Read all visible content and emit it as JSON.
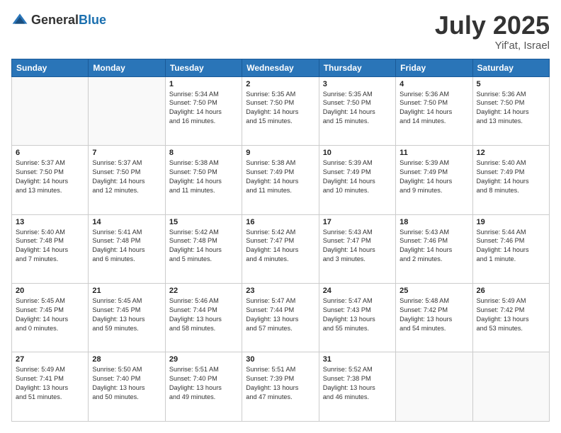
{
  "header": {
    "logo_general": "General",
    "logo_blue": "Blue",
    "month_title": "July 2025",
    "location": "Yif'at, Israel"
  },
  "days_of_week": [
    "Sunday",
    "Monday",
    "Tuesday",
    "Wednesday",
    "Thursday",
    "Friday",
    "Saturday"
  ],
  "weeks": [
    [
      {
        "day": "",
        "info": ""
      },
      {
        "day": "",
        "info": ""
      },
      {
        "day": "1",
        "info": "Sunrise: 5:34 AM\nSunset: 7:50 PM\nDaylight: 14 hours\nand 16 minutes."
      },
      {
        "day": "2",
        "info": "Sunrise: 5:35 AM\nSunset: 7:50 PM\nDaylight: 14 hours\nand 15 minutes."
      },
      {
        "day": "3",
        "info": "Sunrise: 5:35 AM\nSunset: 7:50 PM\nDaylight: 14 hours\nand 15 minutes."
      },
      {
        "day": "4",
        "info": "Sunrise: 5:36 AM\nSunset: 7:50 PM\nDaylight: 14 hours\nand 14 minutes."
      },
      {
        "day": "5",
        "info": "Sunrise: 5:36 AM\nSunset: 7:50 PM\nDaylight: 14 hours\nand 13 minutes."
      }
    ],
    [
      {
        "day": "6",
        "info": "Sunrise: 5:37 AM\nSunset: 7:50 PM\nDaylight: 14 hours\nand 13 minutes."
      },
      {
        "day": "7",
        "info": "Sunrise: 5:37 AM\nSunset: 7:50 PM\nDaylight: 14 hours\nand 12 minutes."
      },
      {
        "day": "8",
        "info": "Sunrise: 5:38 AM\nSunset: 7:50 PM\nDaylight: 14 hours\nand 11 minutes."
      },
      {
        "day": "9",
        "info": "Sunrise: 5:38 AM\nSunset: 7:49 PM\nDaylight: 14 hours\nand 11 minutes."
      },
      {
        "day": "10",
        "info": "Sunrise: 5:39 AM\nSunset: 7:49 PM\nDaylight: 14 hours\nand 10 minutes."
      },
      {
        "day": "11",
        "info": "Sunrise: 5:39 AM\nSunset: 7:49 PM\nDaylight: 14 hours\nand 9 minutes."
      },
      {
        "day": "12",
        "info": "Sunrise: 5:40 AM\nSunset: 7:49 PM\nDaylight: 14 hours\nand 8 minutes."
      }
    ],
    [
      {
        "day": "13",
        "info": "Sunrise: 5:40 AM\nSunset: 7:48 PM\nDaylight: 14 hours\nand 7 minutes."
      },
      {
        "day": "14",
        "info": "Sunrise: 5:41 AM\nSunset: 7:48 PM\nDaylight: 14 hours\nand 6 minutes."
      },
      {
        "day": "15",
        "info": "Sunrise: 5:42 AM\nSunset: 7:48 PM\nDaylight: 14 hours\nand 5 minutes."
      },
      {
        "day": "16",
        "info": "Sunrise: 5:42 AM\nSunset: 7:47 PM\nDaylight: 14 hours\nand 4 minutes."
      },
      {
        "day": "17",
        "info": "Sunrise: 5:43 AM\nSunset: 7:47 PM\nDaylight: 14 hours\nand 3 minutes."
      },
      {
        "day": "18",
        "info": "Sunrise: 5:43 AM\nSunset: 7:46 PM\nDaylight: 14 hours\nand 2 minutes."
      },
      {
        "day": "19",
        "info": "Sunrise: 5:44 AM\nSunset: 7:46 PM\nDaylight: 14 hours\nand 1 minute."
      }
    ],
    [
      {
        "day": "20",
        "info": "Sunrise: 5:45 AM\nSunset: 7:45 PM\nDaylight: 14 hours\nand 0 minutes."
      },
      {
        "day": "21",
        "info": "Sunrise: 5:45 AM\nSunset: 7:45 PM\nDaylight: 13 hours\nand 59 minutes."
      },
      {
        "day": "22",
        "info": "Sunrise: 5:46 AM\nSunset: 7:44 PM\nDaylight: 13 hours\nand 58 minutes."
      },
      {
        "day": "23",
        "info": "Sunrise: 5:47 AM\nSunset: 7:44 PM\nDaylight: 13 hours\nand 57 minutes."
      },
      {
        "day": "24",
        "info": "Sunrise: 5:47 AM\nSunset: 7:43 PM\nDaylight: 13 hours\nand 55 minutes."
      },
      {
        "day": "25",
        "info": "Sunrise: 5:48 AM\nSunset: 7:42 PM\nDaylight: 13 hours\nand 54 minutes."
      },
      {
        "day": "26",
        "info": "Sunrise: 5:49 AM\nSunset: 7:42 PM\nDaylight: 13 hours\nand 53 minutes."
      }
    ],
    [
      {
        "day": "27",
        "info": "Sunrise: 5:49 AM\nSunset: 7:41 PM\nDaylight: 13 hours\nand 51 minutes."
      },
      {
        "day": "28",
        "info": "Sunrise: 5:50 AM\nSunset: 7:40 PM\nDaylight: 13 hours\nand 50 minutes."
      },
      {
        "day": "29",
        "info": "Sunrise: 5:51 AM\nSunset: 7:40 PM\nDaylight: 13 hours\nand 49 minutes."
      },
      {
        "day": "30",
        "info": "Sunrise: 5:51 AM\nSunset: 7:39 PM\nDaylight: 13 hours\nand 47 minutes."
      },
      {
        "day": "31",
        "info": "Sunrise: 5:52 AM\nSunset: 7:38 PM\nDaylight: 13 hours\nand 46 minutes."
      },
      {
        "day": "",
        "info": ""
      },
      {
        "day": "",
        "info": ""
      }
    ]
  ]
}
